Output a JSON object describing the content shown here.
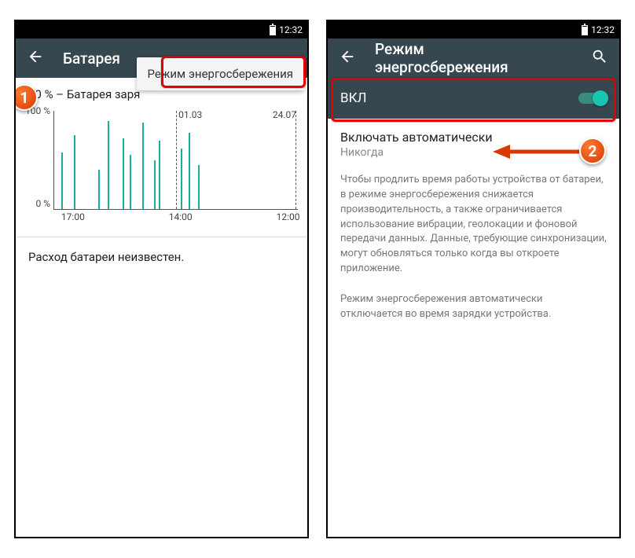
{
  "status": {
    "time": "12:32"
  },
  "left": {
    "title": "Батарея",
    "menu_item": "Режим энергосбережения",
    "summary": "90 % – Батарея заря",
    "y_top": "100 %",
    "y_bot": "0 %",
    "t_mid": "01.03",
    "t_right": "24.07",
    "x1": "17:00",
    "x2": "14:00",
    "x3": "12:00",
    "unknown": "Расход батареи неизвестен."
  },
  "right": {
    "title": "Режим энергосбережения",
    "toggle_label": "ВКЛ",
    "auto_title": "Включать автоматически",
    "auto_sub": "Никогда",
    "desc1": "Чтобы продлить время работы устройства от батареи, в режиме энергосбережения снижается производительность, а также ограничивается использование вибрации, геолокации и фоновой передачи данных. Данные, требующие синхронизации, могут обновляться только когда вы откроете приложение.",
    "desc2": "Режим энергосбережения автоматически отключается во время зарядки устройства."
  },
  "badges": {
    "b1": "1",
    "b2": "2"
  },
  "chart_data": {
    "type": "bar",
    "title": "",
    "ylabel": "%",
    "ylim": [
      0,
      100
    ],
    "x_ticks": [
      "17:00",
      "14:00",
      "12:00"
    ],
    "top_labels": [
      "01.03",
      "24.07"
    ],
    "bars_pct_x": [
      3,
      8,
      18,
      22,
      28,
      31,
      36,
      41,
      43,
      52,
      55,
      59
    ],
    "bars_pct_h": [
      58,
      75,
      40,
      90,
      72,
      55,
      88,
      50,
      70,
      62,
      78,
      45
    ]
  }
}
